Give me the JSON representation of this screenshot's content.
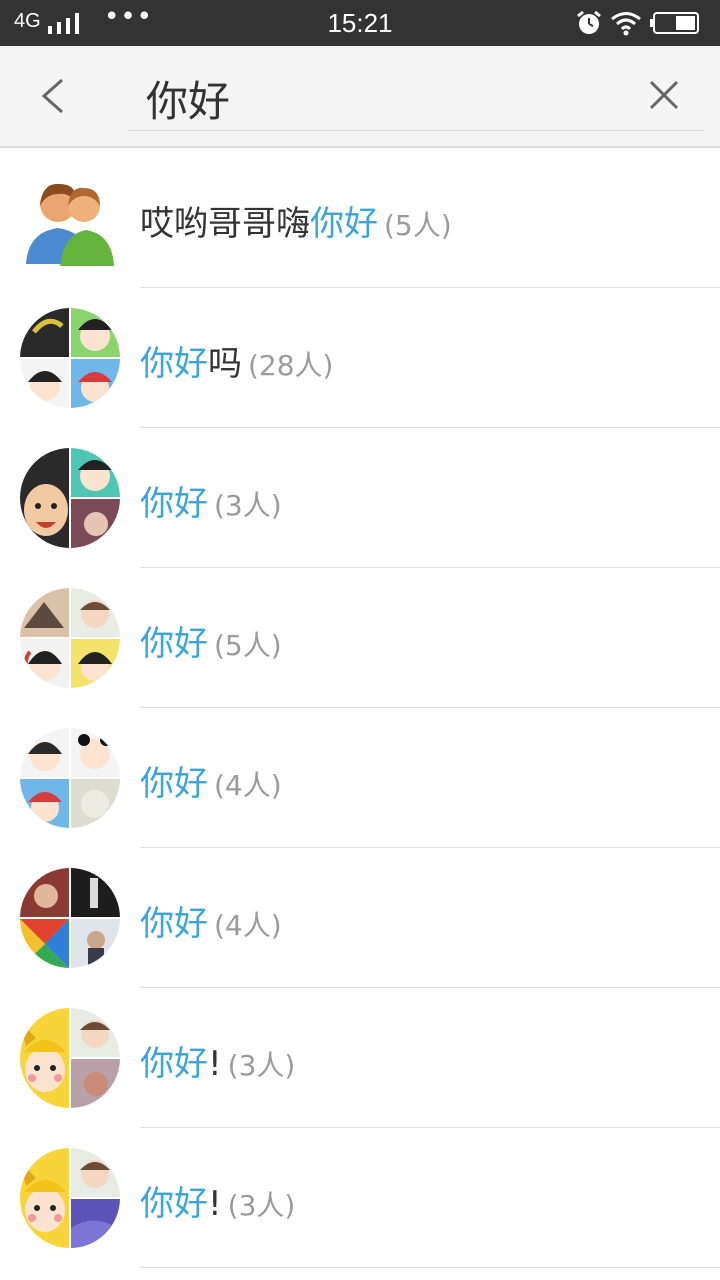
{
  "status_bar": {
    "network": "4G",
    "time": "15:21"
  },
  "search": {
    "query": "你好"
  },
  "results": [
    {
      "prefix": "哎哟哥哥嗨",
      "highlight": "你好",
      "suffix": "",
      "count": "(5人)"
    },
    {
      "prefix": "",
      "highlight": "你好",
      "suffix": "吗",
      "count": "(28人)"
    },
    {
      "prefix": "",
      "highlight": "你好",
      "suffix": "",
      "count": "(3人)"
    },
    {
      "prefix": "",
      "highlight": "你好",
      "suffix": "",
      "count": "(5人)"
    },
    {
      "prefix": "",
      "highlight": "你好",
      "suffix": "",
      "count": "(4人)"
    },
    {
      "prefix": "",
      "highlight": "你好",
      "suffix": "",
      "count": "(4人)"
    },
    {
      "prefix": "",
      "highlight": "你好",
      "suffix": "!",
      "count": "(3人)"
    },
    {
      "prefix": "",
      "highlight": "你好",
      "suffix": "!",
      "count": "(3人)"
    }
  ],
  "colors": {
    "highlight": "#3aa4dd",
    "status_bar": "#333333",
    "header_bg": "#f4f4f4"
  },
  "icons": [
    "back-arrow-icon",
    "clear-icon",
    "signal-icon",
    "alarm-icon",
    "wifi-icon",
    "battery-icon"
  ]
}
